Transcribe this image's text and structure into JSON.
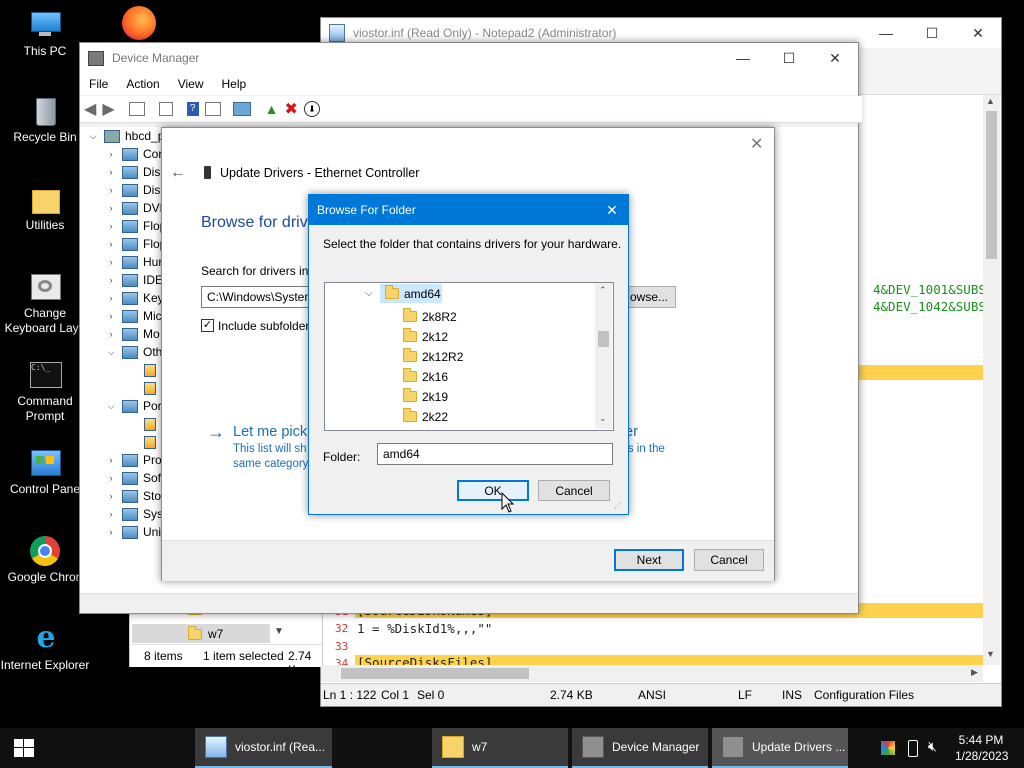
{
  "desktop": {
    "icons": [
      {
        "label": "This PC",
        "icon": "this-pc-icon"
      },
      {
        "label": "Recycle Bin",
        "icon": "recycle-bin-icon"
      },
      {
        "label": "Utilities",
        "icon": "folder-icon"
      },
      {
        "label": "Change Keyboard Layo",
        "icon": "keyboard-layout-icon"
      },
      {
        "label": "Command Prompt",
        "icon": "cmd-icon"
      },
      {
        "label": "Control Pane",
        "icon": "control-panel-icon"
      },
      {
        "label": "Google Chron",
        "icon": "chrome-icon"
      },
      {
        "label": "Internet Explorer",
        "icon": "ie-icon"
      }
    ]
  },
  "notepad": {
    "title": "viostor.inf (Read Only) - Notepad2 (Administrator)",
    "right_text_1": "4&DEV_1001&SUBS",
    "right_text_2": "4&DEV_1042&SUBS",
    "line31_num": "31",
    "line31_text": "[SourceDisksNames]",
    "line32_num": "32",
    "line32_text": "1 = %DiskId1%,,,\"\"",
    "line33_num": "33",
    "line34_num": "34",
    "line34_text": "[SourceDisksFiles]",
    "status": {
      "pos": "Ln 1 : 122",
      "col": "Col 1",
      "sel": "Sel 0",
      "size": "2.74 KB",
      "enc": "ANSI",
      "eol": "LF",
      "ins": "INS",
      "scheme": "Configuration Files"
    }
  },
  "explorer": {
    "row_partial": "2k22",
    "row_selected": "w7",
    "items_count": "8 items",
    "selected": "1 item selected",
    "size": "2.74 K"
  },
  "devmgr": {
    "title": "Device Manager",
    "menu": [
      "File",
      "Action",
      "View",
      "Help"
    ],
    "root": "hbcd_p",
    "tree": [
      "Cor",
      "Disk",
      "Disp",
      "DVD",
      "Flop",
      "Flop",
      "Hur",
      "IDE",
      "Key",
      "Mic",
      "Mo",
      "Oth",
      "",
      "",
      "Por",
      "",
      "",
      "Pro",
      "Soft",
      "Stor",
      "Syst",
      "Uni"
    ]
  },
  "update": {
    "title": "Update Drivers - Ethernet Controller",
    "heading": "Browse for drive",
    "search_label": "Search for drivers in t",
    "path_value": "C:\\Windows\\Systen",
    "browse_label": "owse...",
    "include_sub": "Include subfolder",
    "pick_link": "Let me pick",
    "pick_link_tail": "er",
    "desc_1": "This list will sh",
    "desc_1_tail": "rs in the",
    "desc_2": "same category",
    "next": "Next",
    "cancel": "Cancel"
  },
  "browse": {
    "title": "Browse For Folder",
    "instruction": "Select the folder that contains drivers for your hardware.",
    "selected_folder": "amd64",
    "children": [
      "2k8R2",
      "2k12",
      "2k12R2",
      "2k16",
      "2k19",
      "2k22"
    ],
    "folder_label": "Folder:",
    "folder_value": "amd64",
    "ok": "OK",
    "cancel": "Cancel"
  },
  "taskbar": {
    "tasks": [
      {
        "label": "viostor.inf (Rea...",
        "icon": "notepad-icon"
      },
      {
        "label": "w7",
        "icon": "folder-icon"
      },
      {
        "label": "Device Manager",
        "icon": "device-manager-icon"
      },
      {
        "label": "Update Drivers ...",
        "icon": "update-drivers-icon"
      }
    ],
    "time": "5:44 PM",
    "date": "1/28/2023"
  },
  "colors": {
    "accent": "#0078d7",
    "highlight": "#ffd24d",
    "taskbar": "#101010"
  }
}
